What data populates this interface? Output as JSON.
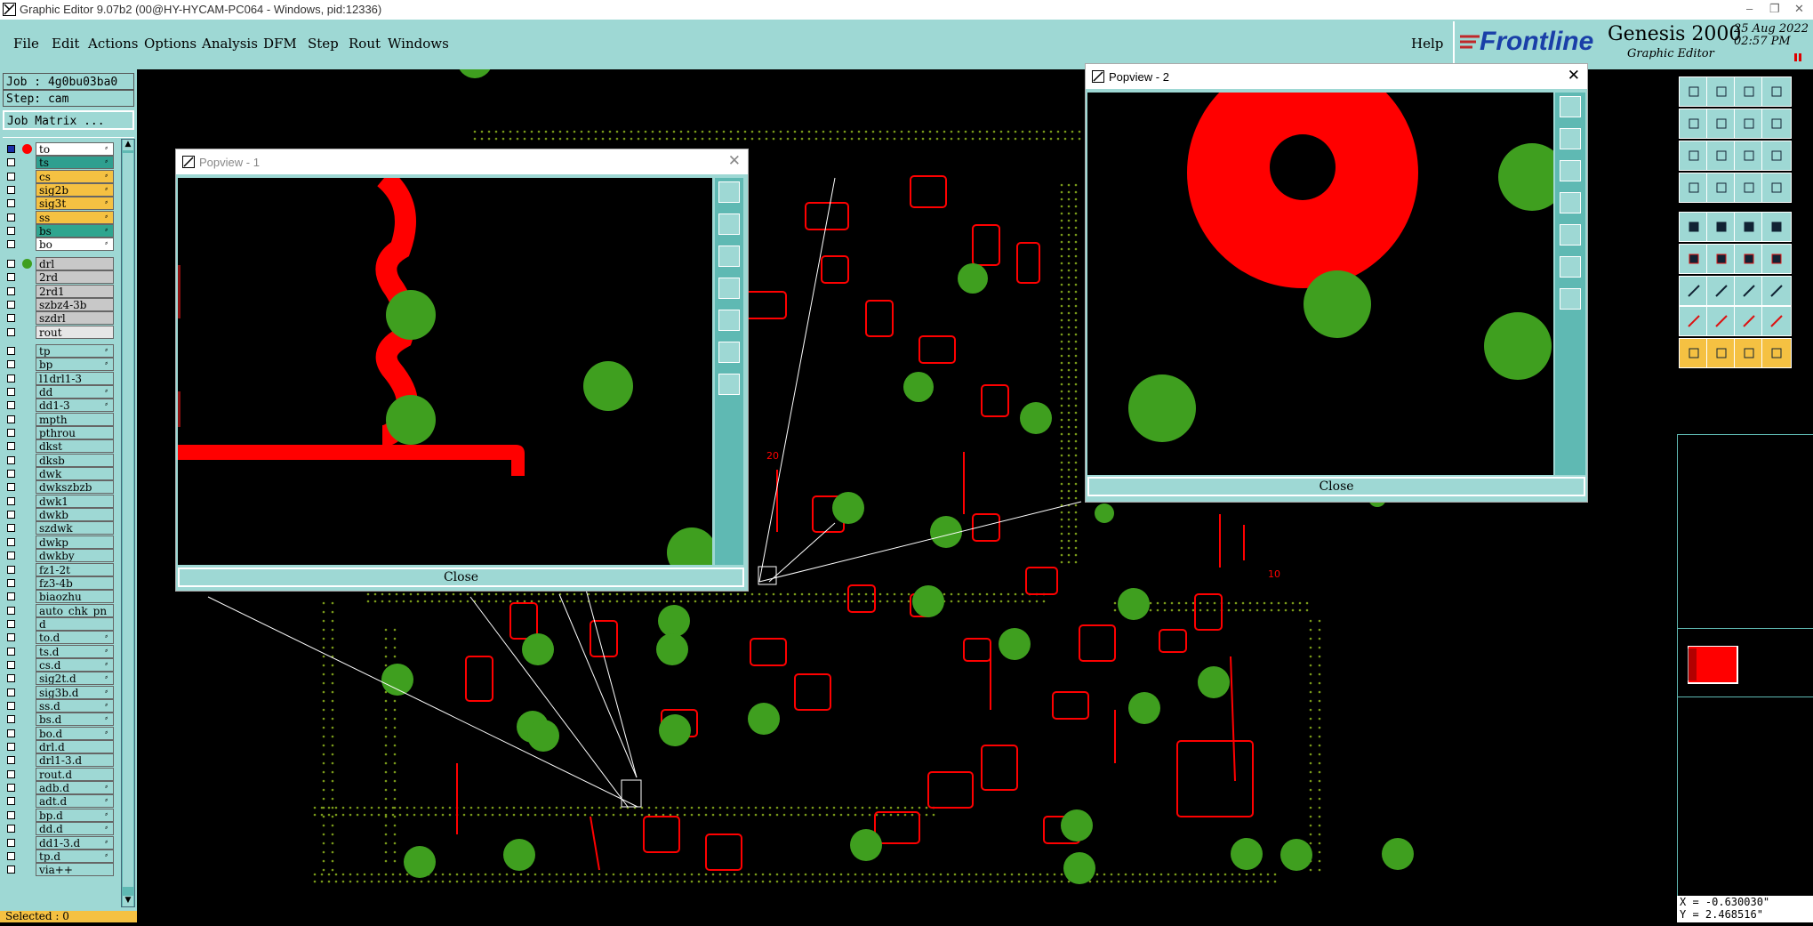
{
  "window": {
    "title": "Graphic Editor 9.07b2 (00@HY-HYCAM-PC064 - Windows, pid:12336)",
    "minimize": "–",
    "restore": "❐",
    "close": "✕"
  },
  "menubar": {
    "items": [
      "File",
      "Edit",
      "Actions",
      "Options",
      "Analysis",
      "DFM",
      "Step",
      "Rout",
      "Windows"
    ],
    "help": "Help"
  },
  "brand": {
    "logo": "Frontline",
    "product": "Genesis 2000",
    "subtitle": "Graphic Editor",
    "date": "25 Aug 2022",
    "time": "02:57 PM"
  },
  "job_panel": {
    "job": "Job : 4g0bu03ba0",
    "step": "Step: cam",
    "matrix_button": "Job Matrix ..."
  },
  "layers": [
    {
      "name": "to",
      "color": "#ffffff",
      "dot": "#ff0000",
      "mark": "⸗"
    },
    {
      "name": "ts",
      "color": "#2f9f8f",
      "dot": "",
      "mark": "⸗"
    },
    {
      "name": "cs",
      "color": "#f5c142",
      "dot": "",
      "mark": "⸗"
    },
    {
      "name": "sig2b",
      "color": "#f5c142",
      "dot": "",
      "mark": "⸗"
    },
    {
      "name": "sig3t",
      "color": "#f5c142",
      "dot": "",
      "mark": "⸗"
    },
    {
      "name": "ss",
      "color": "#f5c142",
      "dot": "",
      "mark": "⸗"
    },
    {
      "name": "bs",
      "color": "#2fa58f",
      "dot": "",
      "mark": "⸗"
    },
    {
      "name": "bo",
      "color": "#ffffff",
      "dot": "",
      "mark": "⸗"
    },
    {
      "name": "drl",
      "color": "#c8c8c8",
      "dot": "#3f9f1f",
      "mark": ""
    },
    {
      "name": "2rd",
      "color": "#c8c8c8",
      "dot": "",
      "mark": ""
    },
    {
      "name": "2rd1",
      "color": "#c8c8c8",
      "dot": "",
      "mark": ""
    },
    {
      "name": "szbz4-3b",
      "color": "#c8c8c8",
      "dot": "",
      "mark": ""
    },
    {
      "name": "szdrl",
      "color": "#c8c8c8",
      "dot": "",
      "mark": ""
    },
    {
      "name": "rout",
      "color": "#e6e6e6",
      "dot": "",
      "mark": ""
    },
    {
      "name": "tp",
      "color": "#9ed8d4",
      "dot": "",
      "mark": "⸗"
    },
    {
      "name": "bp",
      "color": "#9ed8d4",
      "dot": "",
      "mark": "⸗"
    },
    {
      "name": "l1drl1-3",
      "color": "#9ed8d4",
      "dot": "",
      "mark": ""
    },
    {
      "name": "dd",
      "color": "#9ed8d4",
      "dot": "",
      "mark": "⸗"
    },
    {
      "name": "dd1-3",
      "color": "#9ed8d4",
      "dot": "",
      "mark": "⸗"
    },
    {
      "name": "mpth",
      "color": "#9ed8d4",
      "dot": "",
      "mark": ""
    },
    {
      "name": "pthrou",
      "color": "#9ed8d4",
      "dot": "",
      "mark": ""
    },
    {
      "name": "dkst",
      "color": "#9ed8d4",
      "dot": "",
      "mark": ""
    },
    {
      "name": "dksb",
      "color": "#9ed8d4",
      "dot": "",
      "mark": ""
    },
    {
      "name": "dwk",
      "color": "#9ed8d4",
      "dot": "",
      "mark": ""
    },
    {
      "name": "dwkszbzb",
      "color": "#9ed8d4",
      "dot": "",
      "mark": ""
    },
    {
      "name": "dwk1",
      "color": "#9ed8d4",
      "dot": "",
      "mark": ""
    },
    {
      "name": "dwkb",
      "color": "#9ed8d4",
      "dot": "",
      "mark": ""
    },
    {
      "name": "szdwk",
      "color": "#9ed8d4",
      "dot": "",
      "mark": ""
    },
    {
      "name": "dwkp",
      "color": "#9ed8d4",
      "dot": "",
      "mark": ""
    },
    {
      "name": "dwkby",
      "color": "#9ed8d4",
      "dot": "",
      "mark": ""
    },
    {
      "name": "fz1-2t",
      "color": "#9ed8d4",
      "dot": "",
      "mark": ""
    },
    {
      "name": "fz3-4b",
      "color": "#9ed8d4",
      "dot": "",
      "mark": ""
    },
    {
      "name": "biaozhu",
      "color": "#9ed8d4",
      "dot": "",
      "mark": ""
    },
    {
      "name": "auto_chk_pn",
      "color": "#9ed8d4",
      "dot": "",
      "mark": ""
    },
    {
      "name": "d",
      "color": "#9ed8d4",
      "dot": "",
      "mark": ""
    },
    {
      "name": "to.d",
      "color": "#9ed8d4",
      "dot": "",
      "mark": "⸗"
    },
    {
      "name": "ts.d",
      "color": "#9ed8d4",
      "dot": "",
      "mark": "⸗"
    },
    {
      "name": "cs.d",
      "color": "#9ed8d4",
      "dot": "",
      "mark": "⸗"
    },
    {
      "name": "sig2t.d",
      "color": "#9ed8d4",
      "dot": "",
      "mark": "⸗"
    },
    {
      "name": "sig3b.d",
      "color": "#9ed8d4",
      "dot": "",
      "mark": "⸗"
    },
    {
      "name": "ss.d",
      "color": "#9ed8d4",
      "dot": "",
      "mark": "⸗"
    },
    {
      "name": "bs.d",
      "color": "#9ed8d4",
      "dot": "",
      "mark": "⸗"
    },
    {
      "name": "bo.d",
      "color": "#9ed8d4",
      "dot": "",
      "mark": "⸗"
    },
    {
      "name": "drl.d",
      "color": "#9ed8d4",
      "dot": "",
      "mark": ""
    },
    {
      "name": "drl1-3.d",
      "color": "#9ed8d4",
      "dot": "",
      "mark": ""
    },
    {
      "name": "rout.d",
      "color": "#9ed8d4",
      "dot": "",
      "mark": ""
    },
    {
      "name": "adb.d",
      "color": "#9ed8d4",
      "dot": "",
      "mark": "⸗"
    },
    {
      "name": "adt.d",
      "color": "#9ed8d4",
      "dot": "",
      "mark": "⸗"
    },
    {
      "name": "bp.d",
      "color": "#9ed8d4",
      "dot": "",
      "mark": "⸗"
    },
    {
      "name": "dd.d",
      "color": "#9ed8d4",
      "dot": "",
      "mark": "⸗"
    },
    {
      "name": "dd1-3.d",
      "color": "#9ed8d4",
      "dot": "",
      "mark": "⸗"
    },
    {
      "name": "tp.d",
      "color": "#9ed8d4",
      "dot": "",
      "mark": "⸗"
    },
    {
      "name": "via++",
      "color": "#9ed8d4",
      "dot": "",
      "mark": ""
    }
  ],
  "status": {
    "selected": "Selected : 0"
  },
  "coords": {
    "x": "X = -0.630030\"",
    "y": "Y = 2.468516\""
  },
  "popview1": {
    "title": "Popview - 1",
    "close_label": "Close",
    "x_glyph": "✕"
  },
  "popview2": {
    "title": "Popview - 2",
    "close_label": "Close",
    "x_glyph": "✕"
  },
  "canvas": {
    "label_20": "20",
    "label_10": "10"
  },
  "colors": {
    "panel": "#9ed8d4",
    "copper": "#ff0000",
    "drill": "#3f9f1f",
    "highlight": "#f5c142"
  }
}
